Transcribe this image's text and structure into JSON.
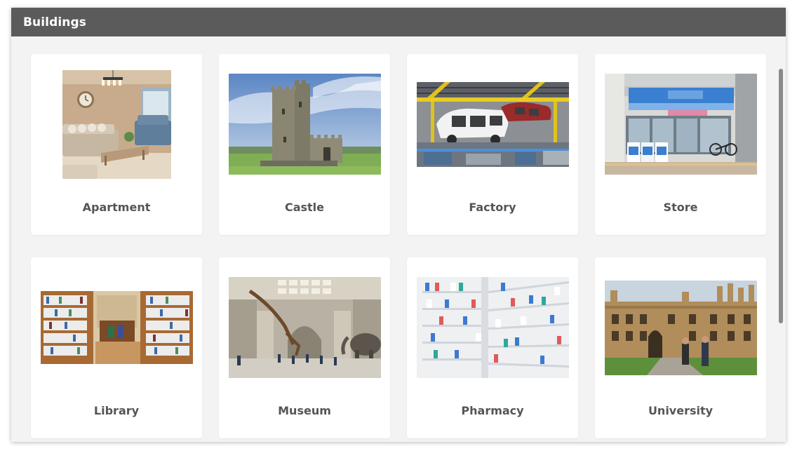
{
  "window": {
    "title": "Buildings"
  },
  "cards": [
    {
      "label": "Apartment",
      "image": "apartment-photo"
    },
    {
      "label": "Castle",
      "image": "castle-photo"
    },
    {
      "label": "Factory",
      "image": "factory-photo"
    },
    {
      "label": "Store",
      "image": "store-photo"
    },
    {
      "label": "Library",
      "image": "library-photo"
    },
    {
      "label": "Museum",
      "image": "museum-photo"
    },
    {
      "label": "Pharmacy",
      "image": "pharmacy-photo"
    },
    {
      "label": "University",
      "image": "university-photo"
    }
  ]
}
